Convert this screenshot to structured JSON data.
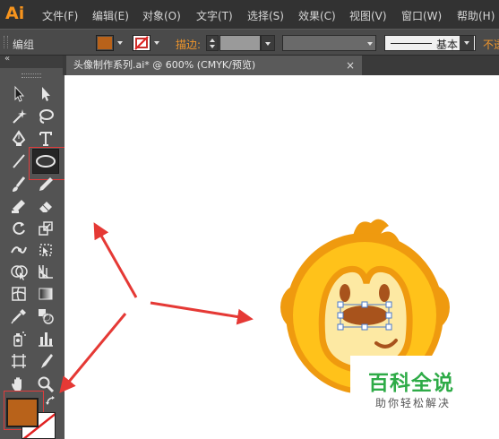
{
  "app": {
    "logo_text": "Ai"
  },
  "menu": [
    {
      "label": "文件(F)"
    },
    {
      "label": "编辑(E)"
    },
    {
      "label": "对象(O)"
    },
    {
      "label": "文字(T)"
    },
    {
      "label": "选择(S)"
    },
    {
      "label": "效果(C)"
    },
    {
      "label": "视图(V)"
    },
    {
      "label": "窗口(W)"
    },
    {
      "label": "帮助(H)"
    }
  ],
  "control_bar": {
    "mode_label": "编组",
    "stroke_label": "描边:",
    "style_value": "基本",
    "opacity_label": "不透",
    "fill_color": "#b8621a"
  },
  "document_tab": {
    "title": "头像制作系列.ai* @ 600% (CMYK/预览)",
    "close_glyph": "×"
  },
  "tools": [
    {
      "icon": "selection-tool-icon"
    },
    {
      "icon": "direct-selection-tool-icon"
    },
    {
      "icon": "magic-wand-tool-icon"
    },
    {
      "icon": "lasso-tool-icon"
    },
    {
      "icon": "pen-tool-icon"
    },
    {
      "icon": "type-tool-icon"
    },
    {
      "icon": "line-segment-tool-icon"
    },
    {
      "icon": "ellipse-tool-icon"
    },
    {
      "icon": "paintbrush-tool-icon"
    },
    {
      "icon": "pencil-tool-icon"
    },
    {
      "icon": "blob-brush-tool-icon"
    },
    {
      "icon": "eraser-tool-icon"
    },
    {
      "icon": "rotate-tool-icon"
    },
    {
      "icon": "scale-tool-icon"
    },
    {
      "icon": "width-tool-icon"
    },
    {
      "icon": "free-transform-tool-icon"
    },
    {
      "icon": "shape-builder-tool-icon"
    },
    {
      "icon": "perspective-grid-tool-icon"
    },
    {
      "icon": "mesh-tool-icon"
    },
    {
      "icon": "gradient-tool-icon"
    },
    {
      "icon": "eyedropper-tool-icon"
    },
    {
      "icon": "blend-tool-icon"
    },
    {
      "icon": "symbol-sprayer-tool-icon"
    },
    {
      "icon": "column-graph-tool-icon"
    },
    {
      "icon": "artboard-tool-icon"
    },
    {
      "icon": "slice-tool-icon"
    },
    {
      "icon": "hand-tool-icon"
    },
    {
      "icon": "zoom-tool-icon"
    }
  ],
  "colors": {
    "fill": "#b8621a",
    "highlight_box": "#e03c3c",
    "arrow": "#e53935",
    "monkey_outer": "#ef9a0f",
    "monkey_ring": "#ffc21a",
    "monkey_face": "#fde9a3",
    "monkey_feature": "#a8531c",
    "watermark": "#2eab47"
  },
  "watermark": {
    "title": "百科全说",
    "subtitle": "助你轻松解决"
  }
}
